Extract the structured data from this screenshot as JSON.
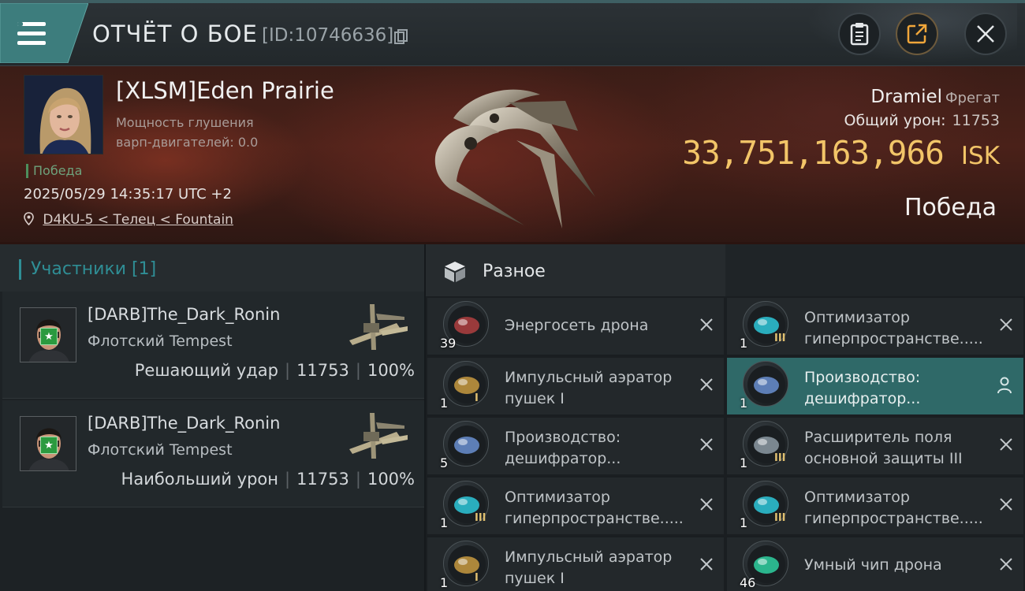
{
  "header": {
    "title": "ОТЧЁТ О БОЕ",
    "battle_id": "[ID:10746636]"
  },
  "victim": {
    "name": "[XLSM]Eden Prairie",
    "jam_line1": "Мощность глушения",
    "jam_line2": "варп-двигателей: 0.0",
    "status": "Победа",
    "datetime": "2025/05/29 14:35:17 UTC +2",
    "location": "D4KU-5 < Телец < Fountain"
  },
  "ship": {
    "name": "Dramiel",
    "class": "Фрегат",
    "total_damage_label": "Общий урон:",
    "total_damage": "11753",
    "isk_value": "33,751,163,966",
    "isk_unit": "ISK",
    "outcome": "Победа"
  },
  "participants": {
    "title": "Участники [1]",
    "rows": [
      {
        "name": "[DARB]The_Dark_Ronin",
        "ship": "Флотский Tempest",
        "role": "Решающий удар",
        "damage": "11753",
        "percent": "100%"
      },
      {
        "name": "[DARB]The_Dark_Ronin",
        "ship": "Флотский Tempest",
        "role": "Наибольший урон",
        "damage": "11753",
        "percent": "100%"
      }
    ]
  },
  "loot": {
    "title": "Разное",
    "items": [
      {
        "name": "Энергосеть дрона",
        "qty": "39",
        "tier": "",
        "action": "close-icon"
      },
      {
        "name": "Оптимизатор гиперпространстве.....",
        "qty": "1",
        "tier": "III",
        "action": "close-icon"
      },
      {
        "name": "Импульсный аэратор пушек I",
        "qty": "1",
        "tier": "I",
        "action": "close-icon"
      },
      {
        "name": "Производство: дешифратор...",
        "qty": "1",
        "tier": "",
        "action": "person-icon"
      },
      {
        "name": "Производство: дешифратор...",
        "qty": "5",
        "tier": "",
        "action": "close-icon"
      },
      {
        "name": "Расширитель поля основной защиты III",
        "qty": "1",
        "tier": "III",
        "action": "close-icon"
      },
      {
        "name": "Оптимизатор гиперпространстве.....",
        "qty": "1",
        "tier": "III",
        "action": "close-icon"
      },
      {
        "name": "Оптимизатор гиперпространстве.....",
        "qty": "1",
        "tier": "III",
        "action": "close-icon"
      },
      {
        "name": "Импульсный аэратор пушек I",
        "qty": "1",
        "tier": "I",
        "action": "close-icon"
      },
      {
        "name": "Умный чип дрона",
        "qty": "46",
        "tier": "",
        "action": "close-icon"
      }
    ]
  }
}
